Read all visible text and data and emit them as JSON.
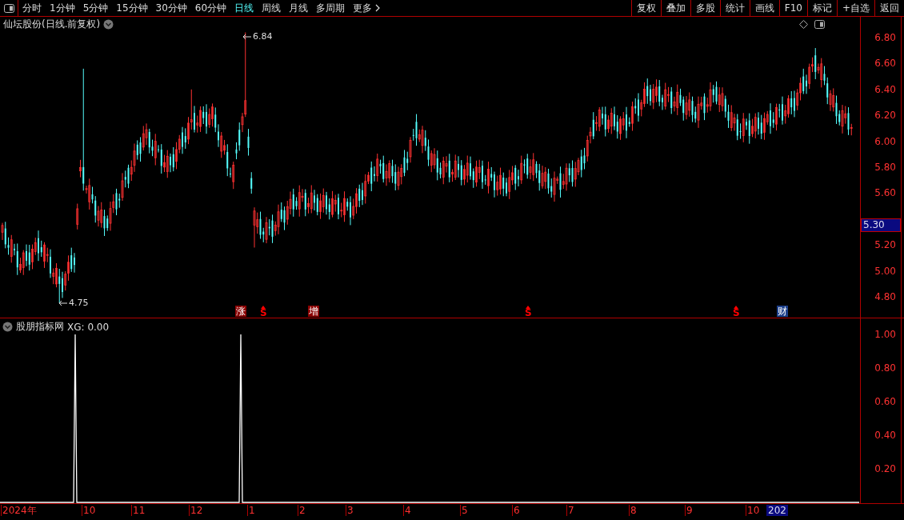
{
  "toolbar": {
    "periods": [
      {
        "label": "分时",
        "selected": false
      },
      {
        "label": "1分钟",
        "selected": false
      },
      {
        "label": "5分钟",
        "selected": false
      },
      {
        "label": "15分钟",
        "selected": false
      },
      {
        "label": "30分钟",
        "selected": false
      },
      {
        "label": "60分钟",
        "selected": false
      },
      {
        "label": "日线",
        "selected": true
      },
      {
        "label": "周线",
        "selected": false
      },
      {
        "label": "月线",
        "selected": false
      },
      {
        "label": "多周期",
        "selected": false
      },
      {
        "label": "更多",
        "selected": false
      }
    ],
    "buttons": [
      "复权",
      "叠加",
      "多股",
      "统计",
      "画线",
      "F10",
      "标记",
      "+自选",
      "返回"
    ]
  },
  "price_chart": {
    "title": "仙坛股份(日线.前复权)",
    "high_label": "6.84",
    "low_label": "4.75",
    "y_ticks": [
      "6.80",
      "6.60",
      "6.40",
      "6.20",
      "6.00",
      "5.80",
      "5.60",
      "5.20",
      "5.00",
      "4.80"
    ],
    "last_price": "5.30",
    "markers": [
      {
        "text": "涨",
        "kind": "badge",
        "color": "#8b0000"
      },
      {
        "text": "S",
        "kind": "signal",
        "color": "#ff0000"
      },
      {
        "text": "增",
        "kind": "badge",
        "color": "#8b0000"
      },
      {
        "text": "S",
        "kind": "signal",
        "color": "#ff0000"
      },
      {
        "text": "S",
        "kind": "signal",
        "color": "#ff0000"
      },
      {
        "text": "财",
        "kind": "badge",
        "color": "#1c3f8a"
      }
    ]
  },
  "indicator": {
    "title": "股朋指标网",
    "reading": "XG: 0.00",
    "y_ticks": [
      "1.00",
      "0.80",
      "0.60",
      "0.40",
      "0.20"
    ]
  },
  "time_axis": {
    "labels": [
      "2024年",
      "10",
      "11",
      "12",
      "1",
      "2",
      "3",
      "4",
      "5",
      "6",
      "7",
      "8",
      "9",
      "10"
    ],
    "current": "202"
  }
}
